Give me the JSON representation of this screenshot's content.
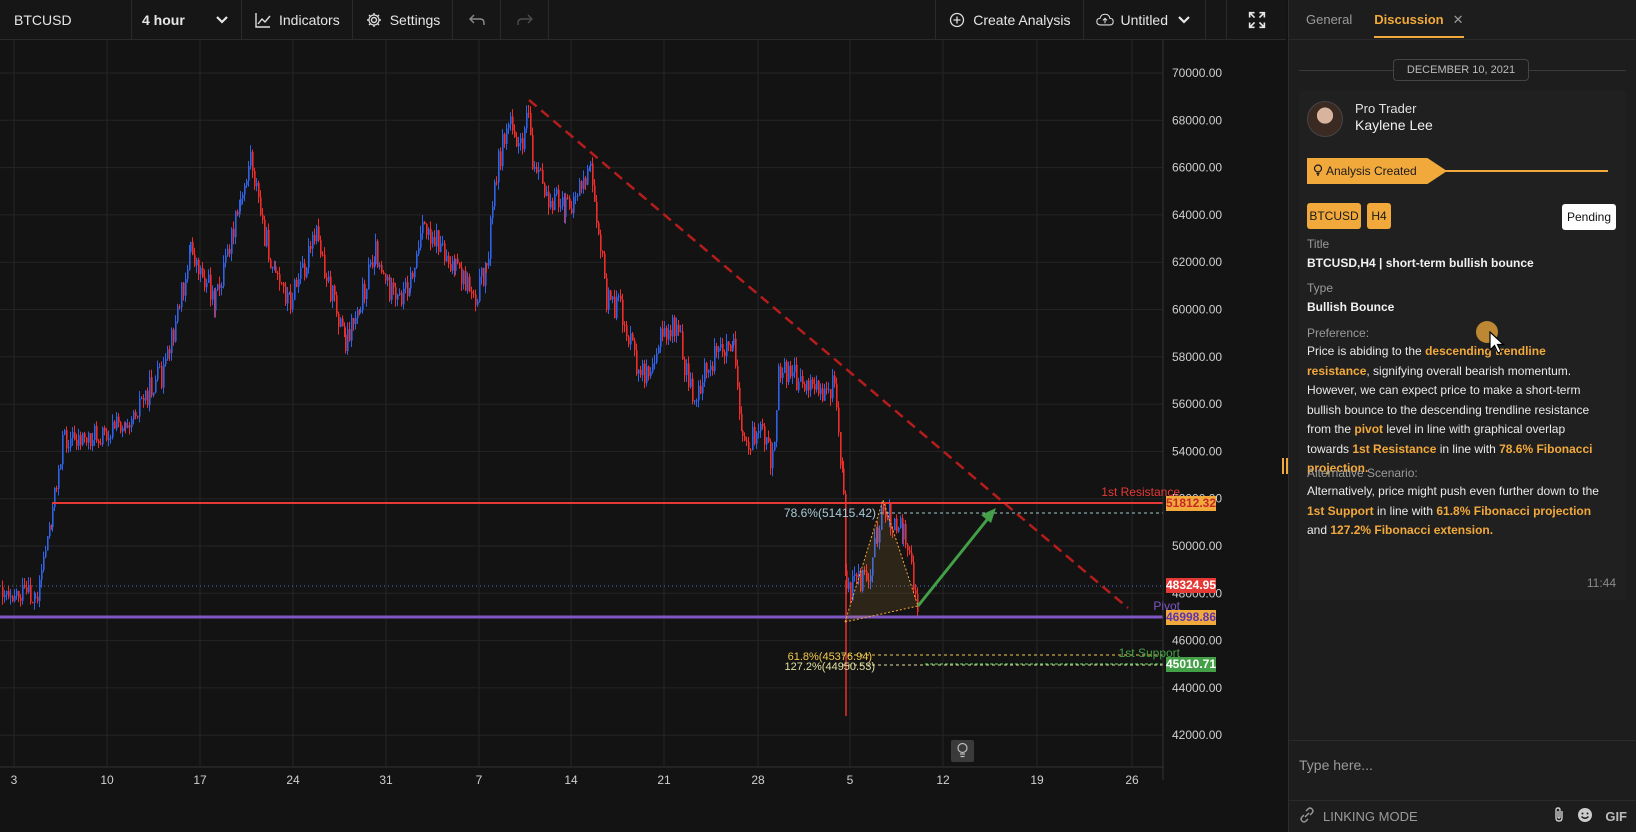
{
  "toolbar": {
    "symbol": "BTCUSD",
    "interval": "4 hour",
    "indicators_label": "Indicators",
    "settings_label": "Settings",
    "create_analysis_label": "Create Analysis",
    "layout_name": "Untitled"
  },
  "chart": {
    "price_labels": [
      "70000.00",
      "68000.00",
      "66000.00",
      "64000.00",
      "62000.00",
      "60000.00",
      "58000.00",
      "56000.00",
      "54000.00",
      "52000.00",
      "50000.00",
      "48000.00",
      "46000.00",
      "44000.00",
      "42000.00"
    ],
    "date_labels": [
      "3",
      "10",
      "17",
      "24",
      "31",
      "7",
      "14",
      "21",
      "28",
      "5",
      "12",
      "19",
      "26"
    ],
    "levels": {
      "resistance": {
        "label": "1st Resistance",
        "price": "51812.32",
        "color": "#e53935"
      },
      "current": {
        "price": "48324.95",
        "color": "#e53935"
      },
      "pivot": {
        "label": "Pivot",
        "price": "46998.86",
        "color": "#7e57c2"
      },
      "support": {
        "label": "1st Support",
        "price": "45010.71",
        "color": "#43a047"
      }
    },
    "fib": {
      "f786": "78.6%(51415.42)",
      "f618": "61.8%(45376.94)",
      "f1272": "127.2%(44950.53)"
    },
    "colors": {
      "up": "#2f62e6",
      "down": "#ef2d2d",
      "trend": "#b71c1c",
      "projection": "#43a047"
    }
  },
  "panel": {
    "tabs": [
      {
        "label": "General"
      },
      {
        "label": "Discussion"
      }
    ],
    "date": "DECEMBER 10, 2021",
    "author": {
      "role": "Pro Trader",
      "name": "Kaylene Lee"
    },
    "status": "Analysis Created",
    "symbol_chip": "BTCUSD",
    "tf_chip": "H4",
    "pending": "Pending",
    "title_label": "Title",
    "title": "BTCUSD,H4 | short-term bullish bounce",
    "type_label": "Type",
    "type": "Bullish Bounce",
    "preference_label": "Preference:",
    "pref": {
      "t1": "Price is abiding to the ",
      "h1": "descending trendline resistance",
      "t2": ", signifying overall bearish momentum. However, we can expect price to make a short-term bullish bounce to the descending trendline resistance from the ",
      "h2": "pivot",
      "t3": " level in line with graphical overlap towards ",
      "h3": "1st Resistance",
      "t4": " in line with ",
      "h4": "78.6% Fibonacci projection."
    },
    "alt_label": "Alternative Scenario:",
    "alt": {
      "t1": "Alternatively, price might push even further down to the ",
      "h1": "1st Support",
      "t2": " in line with ",
      "h2": "61.8% Fibonacci projection",
      "t3": " and ",
      "h3": "127.2% Fibonacci extension."
    },
    "time": "11:44",
    "input_placeholder": "Type here...",
    "linking_mode": "LINKING MODE",
    "gif_label": "GIF"
  }
}
